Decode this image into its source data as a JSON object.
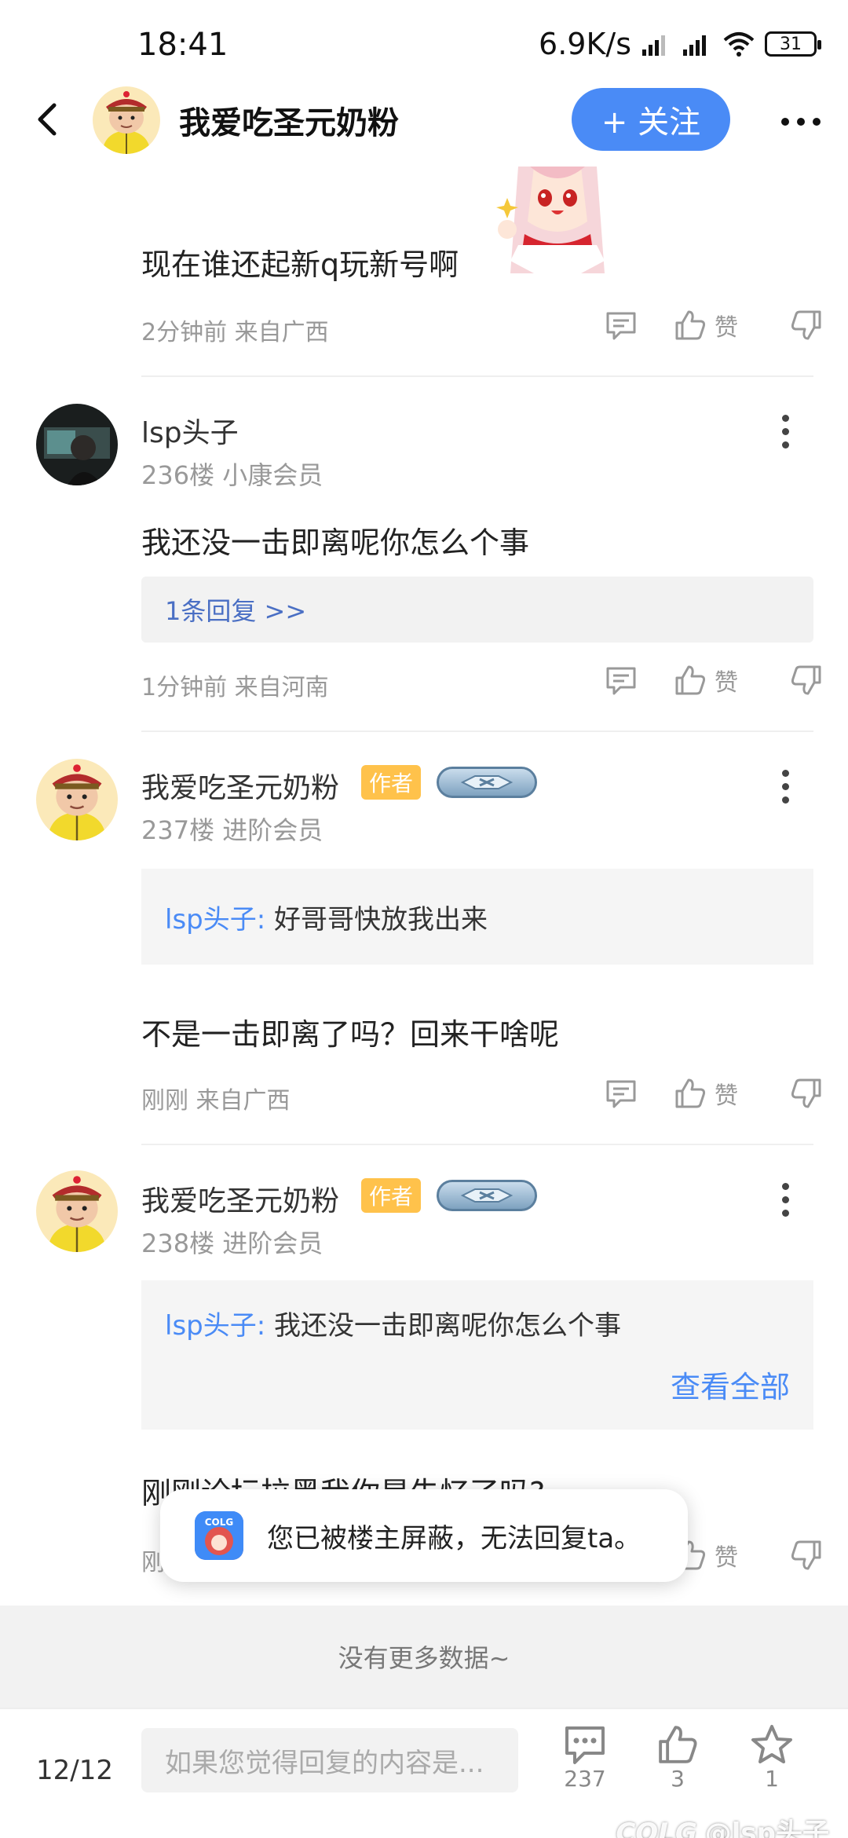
{
  "status_bar": {
    "time": "18:41",
    "net_speed": "6.9K/s",
    "battery": "31"
  },
  "nav": {
    "title": "我爱吃圣元奶粉",
    "follow_label": "+ 关注"
  },
  "posts": [
    {
      "text": "现在谁还起新q玩新号啊",
      "meta": "2分钟前 来自广西",
      "like_label": "赞"
    },
    {
      "username": "lsp头子",
      "floor": "236楼 小康会员",
      "text": "我还没一击即离呢你怎么个事",
      "replies_link": "1条回复 >>",
      "meta": "1分钟前 来自河南",
      "like_label": "赞"
    },
    {
      "username": "我爱吃圣元奶粉",
      "author_badge": "作者",
      "floor": "237楼 进阶会员",
      "quote_name": "lsp头子:",
      "quote_text": "好哥哥快放我出来",
      "text": "不是一击即离了吗？回来干啥呢",
      "meta": "刚刚 来自广西",
      "like_label": "赞"
    },
    {
      "username": "我爱吃圣元奶粉",
      "author_badge": "作者",
      "floor": "238楼 进阶会员",
      "quote_name": "lsp头子:",
      "quote_text": "我还没一击即离呢你怎么个事",
      "see_all": "查看全部",
      "text": "刚刚论坛拉黑我你是失忆了吗?",
      "meta": "刚",
      "like_label": "赞"
    }
  ],
  "toast": {
    "text": "您已被楼主屏蔽，无法回复ta。"
  },
  "no_more": "没有更多数据~",
  "bottom_bar": {
    "page": "12/12",
    "input_placeholder": "如果您觉得回复的内容是...",
    "comments_count": "237",
    "likes_count": "3",
    "favorites_count": "1"
  },
  "watermark": {
    "logo": "COLG",
    "text": "@lsp头子"
  },
  "colors": {
    "accent": "#4a8bf6",
    "author_badge": "#ffc24b"
  }
}
